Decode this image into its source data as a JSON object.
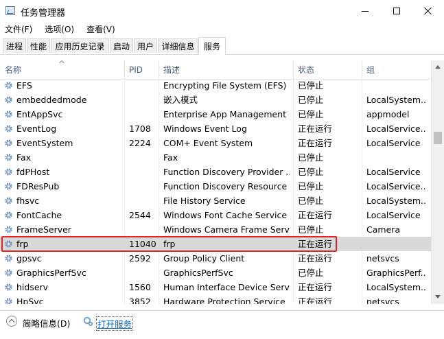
{
  "window": {
    "title": "任务管理器"
  },
  "menu": [
    "文件(F)",
    "选项(O)",
    "查看(V)"
  ],
  "tabs": [
    {
      "label": "进程",
      "active": false
    },
    {
      "label": "性能",
      "active": false
    },
    {
      "label": "应用历史记录",
      "active": false
    },
    {
      "label": "启动",
      "active": false
    },
    {
      "label": "用户",
      "active": false
    },
    {
      "label": "详细信息",
      "active": false
    },
    {
      "label": "服务",
      "active": true
    }
  ],
  "columns": {
    "name": "名称",
    "pid": "PID",
    "desc": "描述",
    "status": "状态",
    "group": "组"
  },
  "icons": {
    "service": "gear-icon",
    "collapse": "chevron-up-icon",
    "open_services": "services-icon"
  },
  "colors": {
    "highlight_border": "#e02424",
    "selected_row": "#d9d9d9",
    "link": "#0066cc"
  },
  "services": [
    {
      "name": "EFS",
      "pid": "",
      "desc": "Encrypting File System (EFS)",
      "status": "已停止",
      "group": ""
    },
    {
      "name": "embeddedmode",
      "pid": "",
      "desc": "嵌入模式",
      "status": "已停止",
      "group": "LocalSystem..."
    },
    {
      "name": "EntAppSvc",
      "pid": "",
      "desc": "Enterprise App Management ...",
      "status": "已停止",
      "group": "appmodel"
    },
    {
      "name": "EventLog",
      "pid": "1708",
      "desc": "Windows Event Log",
      "status": "正在运行",
      "group": "LocalService..."
    },
    {
      "name": "EventSystem",
      "pid": "2224",
      "desc": "COM+ Event System",
      "status": "正在运行",
      "group": "LocalService"
    },
    {
      "name": "Fax",
      "pid": "",
      "desc": "Fax",
      "status": "已停止",
      "group": ""
    },
    {
      "name": "fdPHost",
      "pid": "",
      "desc": "Function Discovery Provider ...",
      "status": "已停止",
      "group": "LocalService"
    },
    {
      "name": "FDResPub",
      "pid": "",
      "desc": "Function Discovery Resource ...",
      "status": "已停止",
      "group": "LocalService..."
    },
    {
      "name": "fhsvc",
      "pid": "",
      "desc": "File History Service",
      "status": "已停止",
      "group": "LocalSystem..."
    },
    {
      "name": "FontCache",
      "pid": "2544",
      "desc": "Windows Font Cache Service",
      "status": "正在运行",
      "group": "LocalService"
    },
    {
      "name": "FrameServer",
      "pid": "",
      "desc": "Windows Camera Frame Serv...",
      "status": "已停止",
      "group": "Camera"
    },
    {
      "name": "frp",
      "pid": "11040",
      "desc": "frp",
      "status": "正在运行",
      "group": "",
      "selected": true
    },
    {
      "name": "gpsvc",
      "pid": "2592",
      "desc": "Group Policy Client",
      "status": "正在运行",
      "group": "netsvcs"
    },
    {
      "name": "GraphicsPerfSvc",
      "pid": "",
      "desc": "GraphicsPerfSvc",
      "status": "已停止",
      "group": "GraphicsPerf..."
    },
    {
      "name": "hidserv",
      "pid": "1560",
      "desc": "Human Interface Device Servi...",
      "status": "正在运行",
      "group": "LocalSystem..."
    },
    {
      "name": "HpSvc",
      "pid": "3852",
      "desc": "Hardware Protection Service",
      "status": "正在运行",
      "group": "netsvcs"
    }
  ],
  "footer": {
    "brief_label": "简略信息(D)",
    "open_services_label": "打开服务"
  }
}
